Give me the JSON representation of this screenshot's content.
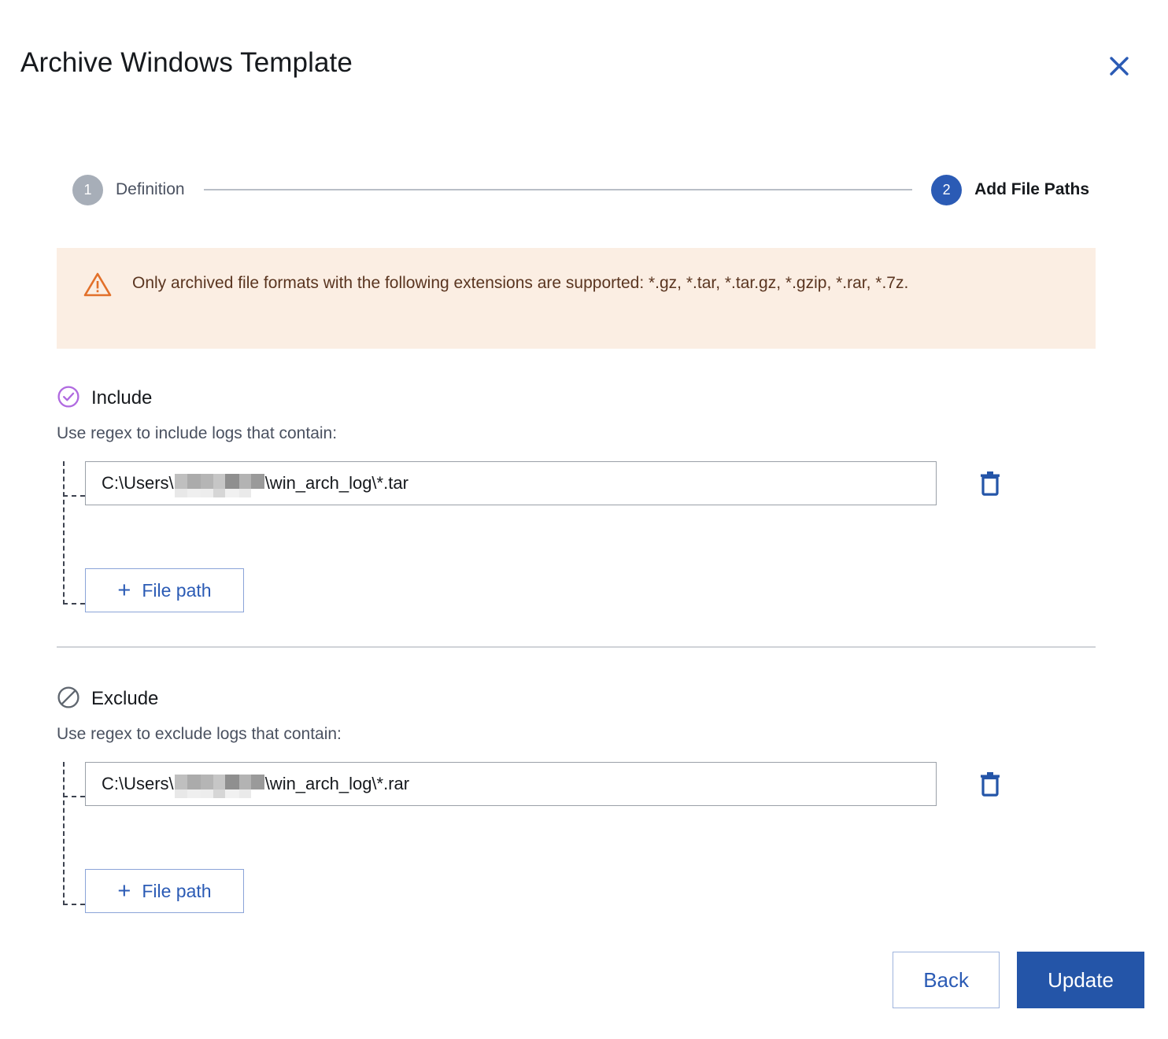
{
  "dialog": {
    "title": "Archive Windows Template",
    "close_icon": "close-icon"
  },
  "stepper": {
    "steps": [
      {
        "number": "1",
        "label": "Definition",
        "state": "inactive"
      },
      {
        "number": "2",
        "label": "Add File Paths",
        "state": "active"
      }
    ]
  },
  "warning": {
    "icon": "warning-triangle-icon",
    "text": "Only archived file formats with the following extensions are supported: *.gz, *.tar, *.tar.gz, *.gzip, *.rar, *.7z.",
    "background_color": "#fbeee3",
    "icon_color": "#e2702a",
    "text_color": "#5a3520"
  },
  "include": {
    "icon": "check-circle-icon",
    "icon_color": "#b06ae0",
    "title": "Include",
    "subtitle": "Use regex to include logs that contain:",
    "paths": [
      {
        "prefix": "C:\\Users\\",
        "redacted": true,
        "suffix": "\\win_arch_log\\*.tar",
        "delete_icon": "trash-icon"
      }
    ],
    "add_button_label": "File path",
    "add_button_icon": "plus-icon"
  },
  "exclude": {
    "icon": "no-entry-icon",
    "icon_color": "#5f666f",
    "title": "Exclude",
    "subtitle": "Use regex to exclude logs that contain:",
    "paths": [
      {
        "prefix": "C:\\Users\\",
        "redacted": true,
        "suffix": "\\win_arch_log\\*.rar",
        "delete_icon": "trash-icon"
      }
    ],
    "add_button_label": "File path",
    "add_button_icon": "plus-icon"
  },
  "footer": {
    "back_label": "Back",
    "update_label": "Update"
  },
  "colors": {
    "accent_blue": "#2455a8",
    "step_active": "#2b5bb5",
    "step_inactive": "#a7aeb8",
    "border_gray": "#9aa0a8"
  }
}
